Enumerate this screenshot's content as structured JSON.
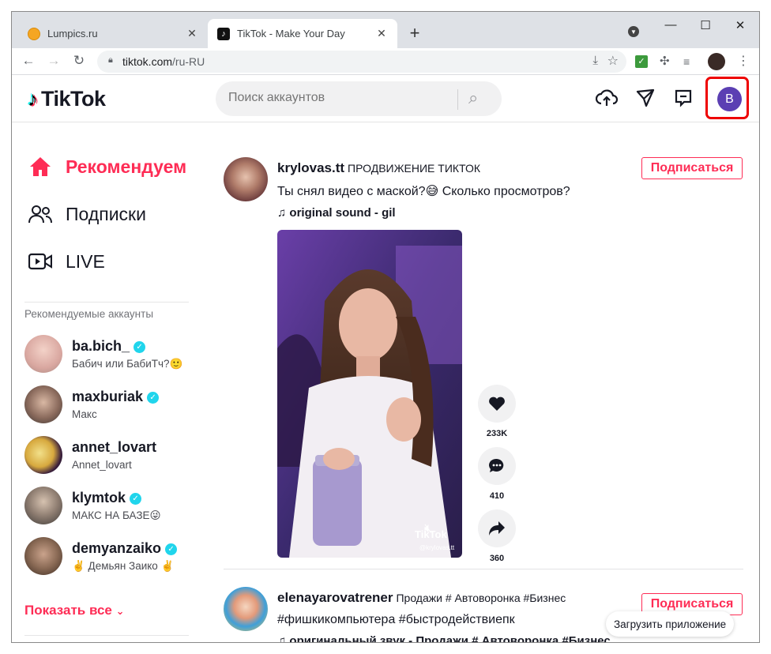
{
  "browser": {
    "tabs": [
      {
        "title": "Lumpics.ru",
        "favicon": "lumpics-favicon",
        "active": false
      },
      {
        "title": "TikTok - Make Your Day",
        "favicon": "tiktok-favicon",
        "active": true
      }
    ],
    "close_glyph": "✕",
    "new_tab_glyph": "+",
    "url_domain": "tiktok.com",
    "url_path": "/ru-RU",
    "window_controls": [
      "—",
      "☐",
      "✕"
    ]
  },
  "header": {
    "logo_text": "TikTok",
    "search_placeholder": "Поиск аккаунтов",
    "avatar_letter": "B",
    "highlight_color": "#e00000"
  },
  "sidebar": {
    "nav": [
      {
        "label": "Рекомендуем",
        "icon": "home-icon",
        "active": true
      },
      {
        "label": "Подписки",
        "icon": "users-icon",
        "active": false
      },
      {
        "label": "LIVE",
        "icon": "live-icon",
        "active": false
      }
    ],
    "suggested_title": "Рекомендуемые аккаунты",
    "accounts": [
      {
        "username": "ba.bich_",
        "nickname": "Бабич или БабиТч?🙂",
        "verified": true,
        "avatar_color": "#d9a7a0"
      },
      {
        "username": "maxburiak",
        "nickname": "Макс",
        "verified": true,
        "avatar_color": "#6b5a52"
      },
      {
        "username": "annet_lovart",
        "nickname": "Annet_lovart",
        "verified": false,
        "avatar_color": "#e0c25a"
      },
      {
        "username": "klymtok",
        "nickname": "МАКС НА БАЗЕ😜",
        "verified": true,
        "avatar_color": "#7d7a74"
      },
      {
        "username": "demyanzaiko",
        "nickname": "✌️ Демьян Заико ✌️",
        "verified": true,
        "avatar_color": "#8a6a55"
      }
    ],
    "show_all": "Показать все"
  },
  "feed": {
    "posts": [
      {
        "username": "krylovas.tt",
        "nickname": "ПРОДВИЖЕНИЕ ТИКТОК",
        "caption": "Ты снял видео с маской?😅 Сколько просмотров?",
        "sound": "original sound - gil",
        "follow_label": "Подписаться",
        "watermark_logo": "TikTok",
        "watermark_user": "@krylovas.tt",
        "likes": "233K",
        "comments": "410",
        "shares": "360"
      },
      {
        "username": "elenayarovatrener",
        "nickname": "Продажи # Автоворонка #Бизнес",
        "caption": "#фишкикомпьютера #быстродействиепк",
        "sound": "оригинальный звук - Продажи # Автоворонка #Бизнес",
        "follow_label": "Подписаться"
      }
    ],
    "get_app": "Загрузить приложение"
  },
  "colors": {
    "brand": "#fe2c55",
    "verified": "#20d5ec",
    "avatar": "#5b3fb3"
  }
}
